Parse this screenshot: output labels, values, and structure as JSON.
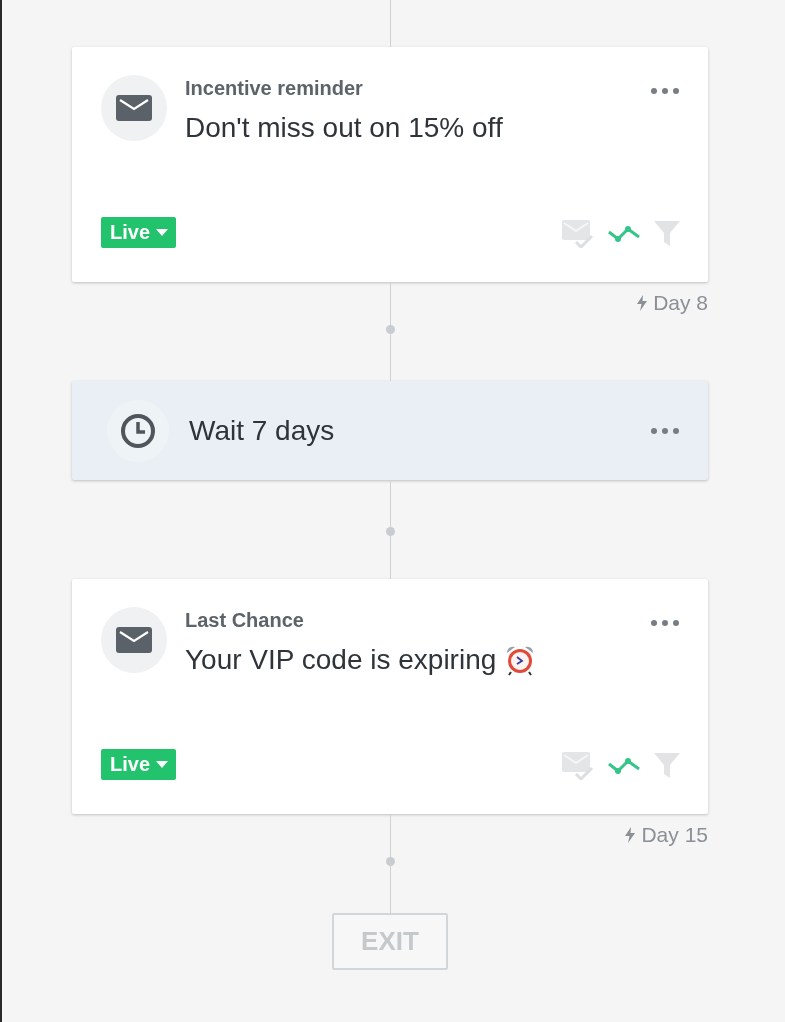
{
  "steps": [
    {
      "kind": "email",
      "title": "Incentive reminder",
      "subject": "Don't miss out on 15% off",
      "status": "Live",
      "day": "Day 8"
    },
    {
      "kind": "wait",
      "label": "Wait 7 days"
    },
    {
      "kind": "email",
      "title": "Last Chance",
      "subject": "Your VIP code is expiring",
      "subject_emoji": {
        "kind": "alarm-clock"
      },
      "status": "Live",
      "day": "Day 15"
    },
    {
      "kind": "exit",
      "label": "EXIT"
    }
  ]
}
